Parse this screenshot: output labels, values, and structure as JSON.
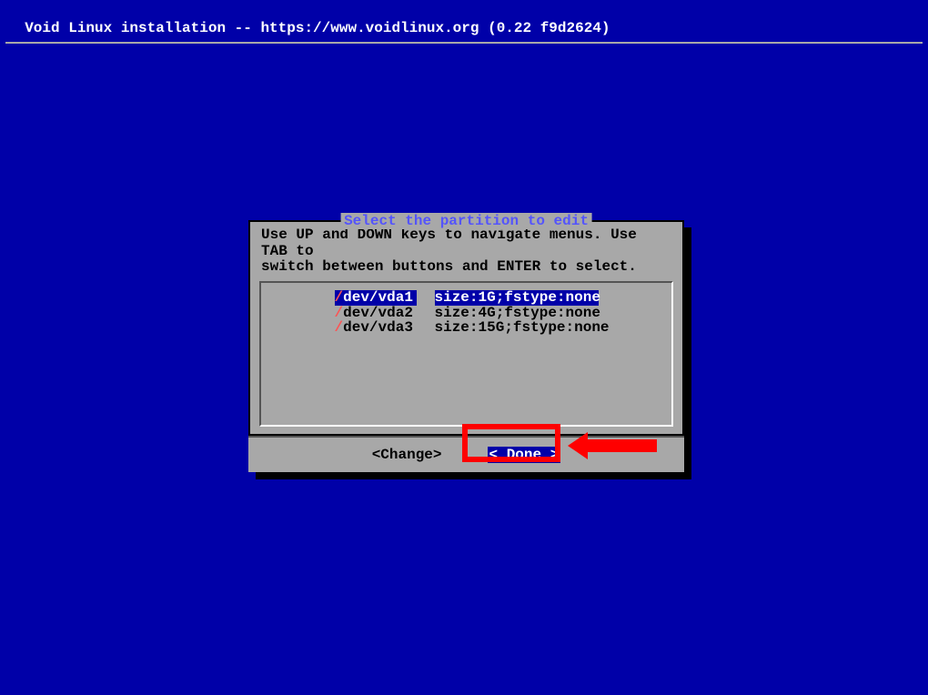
{
  "header": {
    "title": "Void Linux installation -- https://www.voidlinux.org (0.22 f9d2624)"
  },
  "dialog": {
    "title": " Select the partition to edit ",
    "instructions_line1": "Use UP and DOWN keys to navigate menus. Use TAB to",
    "instructions_line2": "switch between buttons and ENTER to select.",
    "partitions": [
      {
        "slash": "/",
        "device": "dev/vda1",
        "size": "size:1G;fstype:none",
        "selected": true
      },
      {
        "slash": "/",
        "device": "dev/vda2",
        "size": "size:4G;fstype:none",
        "selected": false
      },
      {
        "slash": "/",
        "device": "dev/vda3",
        "size": "size:15G;fstype:none",
        "selected": false
      }
    ],
    "buttons": {
      "change": "<Change>",
      "done": "< Done >"
    }
  }
}
